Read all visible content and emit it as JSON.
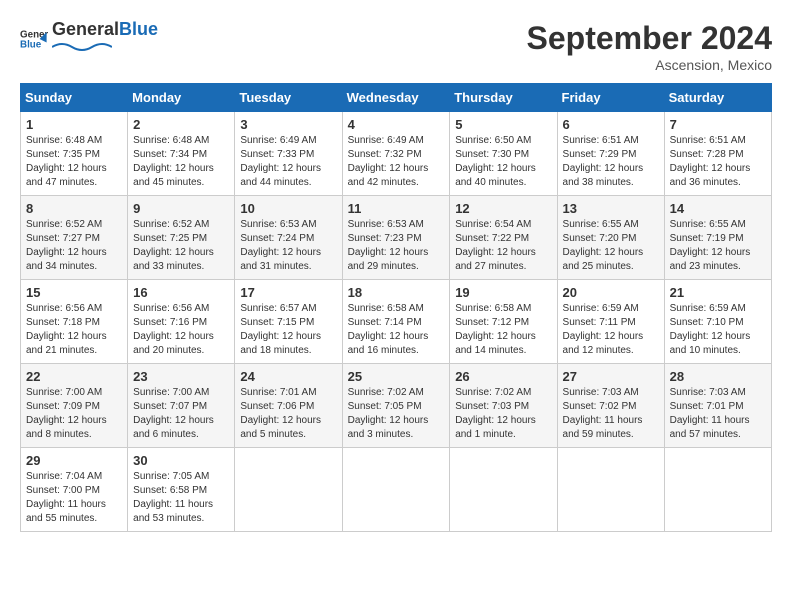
{
  "header": {
    "logo_general": "General",
    "logo_blue": "Blue",
    "month_title": "September 2024",
    "location": "Ascension, Mexico"
  },
  "days_of_week": [
    "Sunday",
    "Monday",
    "Tuesday",
    "Wednesday",
    "Thursday",
    "Friday",
    "Saturday"
  ],
  "weeks": [
    [
      {
        "day": "1",
        "sunrise": "6:48 AM",
        "sunset": "7:35 PM",
        "daylight": "12 hours and 47 minutes."
      },
      {
        "day": "2",
        "sunrise": "6:48 AM",
        "sunset": "7:34 PM",
        "daylight": "12 hours and 45 minutes."
      },
      {
        "day": "3",
        "sunrise": "6:49 AM",
        "sunset": "7:33 PM",
        "daylight": "12 hours and 44 minutes."
      },
      {
        "day": "4",
        "sunrise": "6:49 AM",
        "sunset": "7:32 PM",
        "daylight": "12 hours and 42 minutes."
      },
      {
        "day": "5",
        "sunrise": "6:50 AM",
        "sunset": "7:30 PM",
        "daylight": "12 hours and 40 minutes."
      },
      {
        "day": "6",
        "sunrise": "6:51 AM",
        "sunset": "7:29 PM",
        "daylight": "12 hours and 38 minutes."
      },
      {
        "day": "7",
        "sunrise": "6:51 AM",
        "sunset": "7:28 PM",
        "daylight": "12 hours and 36 minutes."
      }
    ],
    [
      {
        "day": "8",
        "sunrise": "6:52 AM",
        "sunset": "7:27 PM",
        "daylight": "12 hours and 34 minutes."
      },
      {
        "day": "9",
        "sunrise": "6:52 AM",
        "sunset": "7:25 PM",
        "daylight": "12 hours and 33 minutes."
      },
      {
        "day": "10",
        "sunrise": "6:53 AM",
        "sunset": "7:24 PM",
        "daylight": "12 hours and 31 minutes."
      },
      {
        "day": "11",
        "sunrise": "6:53 AM",
        "sunset": "7:23 PM",
        "daylight": "12 hours and 29 minutes."
      },
      {
        "day": "12",
        "sunrise": "6:54 AM",
        "sunset": "7:22 PM",
        "daylight": "12 hours and 27 minutes."
      },
      {
        "day": "13",
        "sunrise": "6:55 AM",
        "sunset": "7:20 PM",
        "daylight": "12 hours and 25 minutes."
      },
      {
        "day": "14",
        "sunrise": "6:55 AM",
        "sunset": "7:19 PM",
        "daylight": "12 hours and 23 minutes."
      }
    ],
    [
      {
        "day": "15",
        "sunrise": "6:56 AM",
        "sunset": "7:18 PM",
        "daylight": "12 hours and 21 minutes."
      },
      {
        "day": "16",
        "sunrise": "6:56 AM",
        "sunset": "7:16 PM",
        "daylight": "12 hours and 20 minutes."
      },
      {
        "day": "17",
        "sunrise": "6:57 AM",
        "sunset": "7:15 PM",
        "daylight": "12 hours and 18 minutes."
      },
      {
        "day": "18",
        "sunrise": "6:58 AM",
        "sunset": "7:14 PM",
        "daylight": "12 hours and 16 minutes."
      },
      {
        "day": "19",
        "sunrise": "6:58 AM",
        "sunset": "7:12 PM",
        "daylight": "12 hours and 14 minutes."
      },
      {
        "day": "20",
        "sunrise": "6:59 AM",
        "sunset": "7:11 PM",
        "daylight": "12 hours and 12 minutes."
      },
      {
        "day": "21",
        "sunrise": "6:59 AM",
        "sunset": "7:10 PM",
        "daylight": "12 hours and 10 minutes."
      }
    ],
    [
      {
        "day": "22",
        "sunrise": "7:00 AM",
        "sunset": "7:09 PM",
        "daylight": "12 hours and 8 minutes."
      },
      {
        "day": "23",
        "sunrise": "7:00 AM",
        "sunset": "7:07 PM",
        "daylight": "12 hours and 6 minutes."
      },
      {
        "day": "24",
        "sunrise": "7:01 AM",
        "sunset": "7:06 PM",
        "daylight": "12 hours and 5 minutes."
      },
      {
        "day": "25",
        "sunrise": "7:02 AM",
        "sunset": "7:05 PM",
        "daylight": "12 hours and 3 minutes."
      },
      {
        "day": "26",
        "sunrise": "7:02 AM",
        "sunset": "7:03 PM",
        "daylight": "12 hours and 1 minute."
      },
      {
        "day": "27",
        "sunrise": "7:03 AM",
        "sunset": "7:02 PM",
        "daylight": "11 hours and 59 minutes."
      },
      {
        "day": "28",
        "sunrise": "7:03 AM",
        "sunset": "7:01 PM",
        "daylight": "11 hours and 57 minutes."
      }
    ],
    [
      {
        "day": "29",
        "sunrise": "7:04 AM",
        "sunset": "7:00 PM",
        "daylight": "11 hours and 55 minutes."
      },
      {
        "day": "30",
        "sunrise": "7:05 AM",
        "sunset": "6:58 PM",
        "daylight": "11 hours and 53 minutes."
      },
      null,
      null,
      null,
      null,
      null
    ]
  ]
}
